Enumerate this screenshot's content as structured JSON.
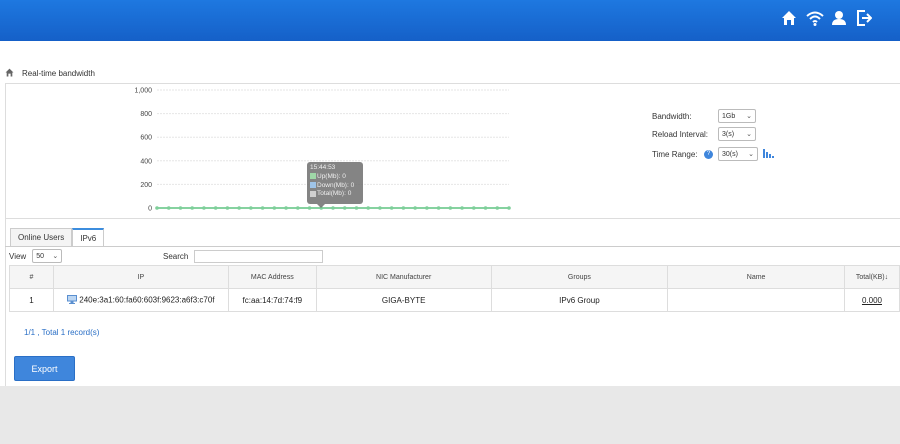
{
  "header": {
    "icons": [
      "home-icon",
      "wifi-icon",
      "user-icon",
      "logout-icon"
    ]
  },
  "breadcrumb": {
    "label": "Real-time  bandwidth"
  },
  "chart_data": {
    "type": "line",
    "y_ticks": [
      "1,000",
      "800",
      "600",
      "400",
      "200",
      "0"
    ],
    "ylim": [
      0,
      1000
    ],
    "series": [
      {
        "name": "Up(Mb)",
        "values": [
          0,
          0,
          0,
          0,
          0,
          0,
          0,
          0,
          0,
          0,
          0,
          0,
          0,
          0,
          0,
          0,
          0,
          0,
          0,
          0,
          0,
          0,
          0,
          0,
          0,
          0,
          0,
          0,
          0,
          0,
          0
        ]
      },
      {
        "name": "Down(Mb)",
        "values": [
          0,
          0,
          0,
          0,
          0,
          0,
          0,
          0,
          0,
          0,
          0,
          0,
          0,
          0,
          0,
          0,
          0,
          0,
          0,
          0,
          0,
          0,
          0,
          0,
          0,
          0,
          0,
          0,
          0,
          0,
          0
        ]
      },
      {
        "name": "Total(Mb)",
        "values": [
          0,
          0,
          0,
          0,
          0,
          0,
          0,
          0,
          0,
          0,
          0,
          0,
          0,
          0,
          0,
          0,
          0,
          0,
          0,
          0,
          0,
          0,
          0,
          0,
          0,
          0,
          0,
          0,
          0,
          0,
          0
        ]
      }
    ],
    "grid": true,
    "colors": {
      "line": "#7fcf9a",
      "point": "#7fcf9a"
    },
    "tooltip": {
      "time": "15:44:53",
      "lines": [
        "Up(Mb): 0",
        "Down(Mb): 0",
        "Total(Mb): 0"
      ],
      "swatch_colors": [
        "#9fd8a8",
        "#9fc4e8",
        "#d0d0d0"
      ]
    }
  },
  "controls": {
    "bandwidth": {
      "label": "Bandwidth:",
      "value": "1Gb"
    },
    "reload": {
      "label": "Reload  Interval:",
      "value": "3(s)"
    },
    "time_range": {
      "label": "Time  Range:",
      "help": "?",
      "value": "30(s)"
    }
  },
  "tabs": [
    {
      "label": "Online  Users",
      "active": false
    },
    {
      "label": "IPv6",
      "active": true
    }
  ],
  "table_controls": {
    "view_label": "View",
    "view_value": "50",
    "search_label": "Search",
    "search_value": ""
  },
  "table": {
    "headers": [
      "#",
      "IP",
      "MAC  Address",
      "NIC  Manufacturer",
      "Groups",
      "Name",
      "Total(KB)↓"
    ],
    "rows": [
      [
        "1",
        "240e:3a1:60:fa60:603f:9623:a6f3:c70f",
        "fc:aa:14:7d:74:f9",
        "GIGA-BYTE",
        "IPv6  Group",
        "",
        "0.000"
      ]
    ]
  },
  "pager": {
    "text": "1/1  ,  Total  1  record(s)"
  },
  "export": {
    "label": "Export"
  },
  "colors": {
    "topbar": "#1a6ad6",
    "accent": "#3f86dc",
    "link": "#2a6fc6"
  }
}
